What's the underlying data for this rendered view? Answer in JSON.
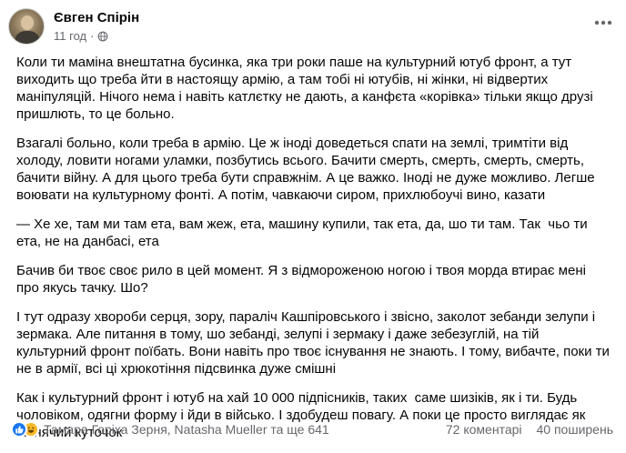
{
  "post": {
    "author": "Євген Спірін",
    "time": "11 год",
    "separator": "·",
    "paragraphs": [
      "Коли ти маміна внештатна бусинка, яка три роки паше на культурний ютуб фронт, а тут виходить що треба йти в настоящу армію, а там тобі ні ютубів, ні жінки, ні відвертих маніпуляцій. Нічого нема і навіть катлєтку не дають, а канфєта «корівка» тільки якщо друзі пришлють, то це больно.",
      "Взагалі больно, коли треба в армію. Це ж іноді доведеться спати на землі, тримтіти від холоду, ловити ногами уламки, позбутись всього. Бачити смерть, смерть, смерть, смерть, бачити війну. А для цього треба бути справжнім. А це важко. Іноді не дуже можливо. Легше воювати на культурному фонті. А потім, чавкаючи сиром, прихлюбоучі вино, казати",
      "— Хе хе, там ми там ета, вам жеж, ета, машину купили, так ета, да, шо ти там. Так  чьо ти ета, не на данбасі, ета",
      "Бачив би твоє своє рило в цей момент. Я з відмороженою ногою і твоя морда втирає мені про якусь тачку. Шо?",
      "І тут одразу хвороби серця, зору, параліч Кашпіровського і звісно, заколот зебанди зелупи і зермака. Але питання в тому, шо зебанді, зелупі і зермаку і даже зебезуглій, на тій культурний фронт поїбать. Вони навіть про твоє існування не знають. І тому, вибачте, поки ти не в армії, всі ці хрюкотіння підсвинка дуже смішні",
      "Как і культурний фронт і ютуб на хай 10 000 підпісників, таких  саме шизіків, як і ти. Будь чоловіком, одягни форму і йди в військо. І здобудеш повагу. А поки це просто виглядає як півнячий куточок"
    ]
  },
  "footer": {
    "reactors": "Тамара Горіха Зерня, Natasha Mueller та ще 641",
    "comments": "72 коментарі",
    "shares": "40 поширень"
  },
  "icons": {
    "globe": "globe-icon",
    "more": "more-options-icon",
    "like": "like-reaction-icon",
    "haha": "haha-reaction-icon"
  },
  "colors": {
    "text": "#050505",
    "secondary": "#65676b",
    "like_blue": "#1877f2",
    "haha_yellow": "#f7b928"
  }
}
